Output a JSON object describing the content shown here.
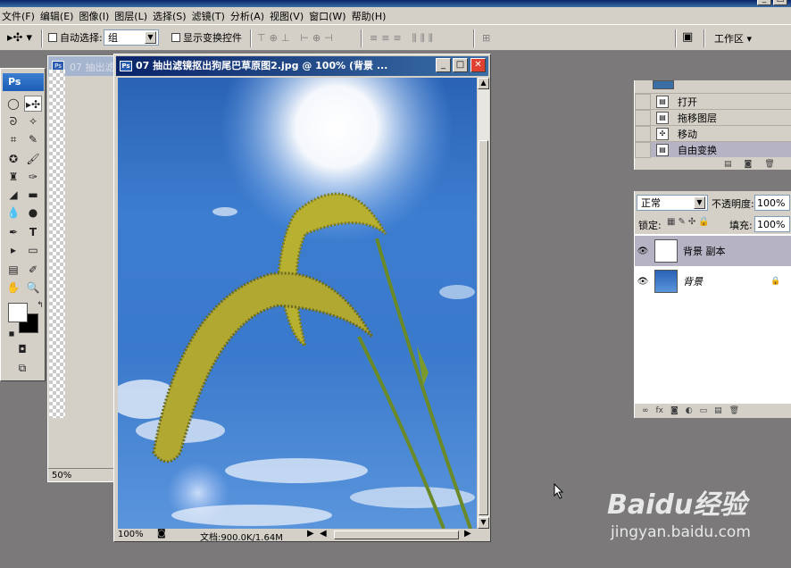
{
  "window": {
    "title_hidden": ""
  },
  "menu": [
    "文件(F)",
    "编辑(E)",
    "图像(I)",
    "图层(L)",
    "选择(S)",
    "滤镜(T)",
    "分析(A)",
    "视图(V)",
    "窗口(W)",
    "帮助(H)"
  ],
  "options": {
    "auto_select_label": "自动选择:",
    "auto_select_value": "组",
    "show_transform_label": "显示变换控件",
    "workspace_label": "工作区 ▾"
  },
  "toolbox": {
    "logo": "Ps"
  },
  "back_doc": {
    "title": "07 抽出滤",
    "zoom": "50%"
  },
  "doc": {
    "title": "07 抽出滤镜抠出狗尾巴草原图2.jpg @ 100% (背景 ...",
    "zoom": "100%",
    "info": "文档:900.0K/1.64M"
  },
  "history": {
    "items": [
      {
        "label": "打开",
        "icon": "doc-icon"
      },
      {
        "label": "拖移图层",
        "icon": "doc-icon"
      },
      {
        "label": "移动",
        "icon": "move-icon"
      },
      {
        "label": "自由变换",
        "icon": "doc-icon"
      }
    ]
  },
  "layers": {
    "blend_mode": "正常",
    "opacity_label": "不透明度:",
    "opacity_value": "100%",
    "lock_label": "锁定:",
    "fill_label": "填充:",
    "fill_value": "100%",
    "items": [
      {
        "name": "背景 副本"
      },
      {
        "name": "背景"
      }
    ]
  },
  "watermark": {
    "logo": "Baidu经验",
    "url": "jingyan.baidu.com"
  }
}
